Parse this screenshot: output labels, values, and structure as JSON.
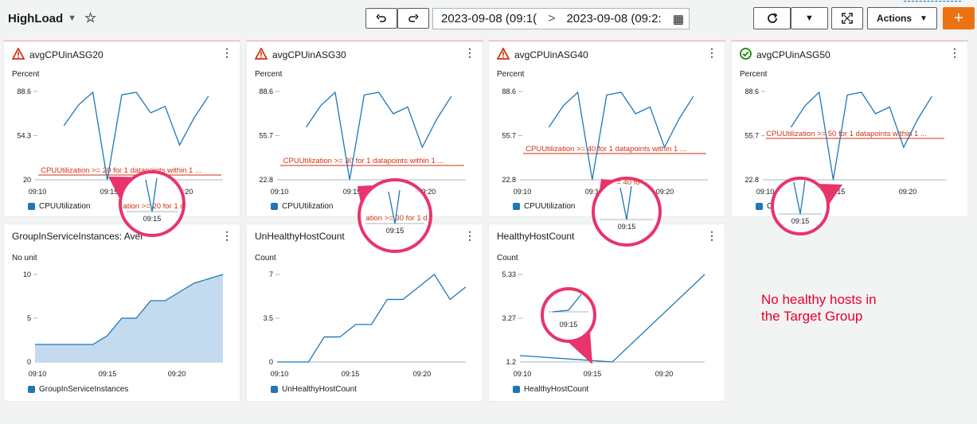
{
  "header": {
    "title": "HighLoad",
    "undo_icon": "undo-icon",
    "redo_icon": "redo-icon",
    "range_start": "2023-09-08 (09:1(",
    "range_end": "2023-09-08 (09:2:",
    "actions_label": "Actions",
    "add_label": "+"
  },
  "colors": {
    "series": "#1f77b4",
    "alarm": "#d13212",
    "ok": "#1d8102",
    "annotation": "#e8346b",
    "accent": "#ec7211"
  },
  "widgets": [
    {
      "title": "avgCPUinASG20",
      "status": "alarm",
      "unit": "Percent",
      "ticks": [
        "88.6",
        "54.3",
        "20"
      ],
      "xticks": [
        "09:10",
        "09:15",
        "09:20"
      ],
      "threshold_label": "CPUUtilization >= 20 for 1 datapoints within 1 ...",
      "legend": "CPUUtilization",
      "zoom_label": "09:15",
      "zoom_text": "ation >= 20 for 1 d"
    },
    {
      "title": "avgCPUinASG30",
      "status": "alarm",
      "unit": "Percent",
      "ticks": [
        "88.6",
        "55.7",
        "22.8"
      ],
      "xticks": [
        "09:10",
        "09:15",
        "09:20"
      ],
      "threshold_label": "CPUUtilization >= 30 for 1 datapoints within 1 ...",
      "legend": "CPUUtilization",
      "zoom_label": "09:15",
      "zoom_text": "ation >= 30 for 1 d"
    },
    {
      "title": "avgCPUinASG40",
      "status": "alarm",
      "unit": "Percent",
      "ticks": [
        "88.6",
        "55.7",
        "22.8"
      ],
      "xticks": [
        "09:10",
        "09:15",
        "09:20"
      ],
      "threshold_label": "CPUUtilization >= 40 for 1 datapoints within 1 ...",
      "legend": "CPUUtilization",
      "zoom_label": "09:15",
      "zoom_text": "= 40 fo"
    },
    {
      "title": "avgCPUinASG50",
      "status": "ok",
      "unit": "Percent",
      "ticks": [
        "88.6",
        "55.7",
        "22.8"
      ],
      "xticks": [
        "09:10",
        "09:15",
        "09:20"
      ],
      "threshold_label": "CPUUtilization >= 50 for 1 datapoints within 1 ...",
      "legend": "C",
      "zoom_label": "09:15",
      "zoom_text": ""
    },
    {
      "title": "GroupInServiceInstances: Average",
      "status": "none",
      "unit": "No unit",
      "ticks": [
        "10",
        "5",
        "0"
      ],
      "xticks": [
        "09:10",
        "09:15",
        "09:20"
      ],
      "legend": "GroupInServiceInstances"
    },
    {
      "title": "UnHealthyHostCount",
      "status": "none",
      "unit": "Count",
      "ticks": [
        "7",
        "3.5",
        "0"
      ],
      "xticks": [
        "09:10",
        "09:15",
        "09:20"
      ],
      "legend": "UnHealthyHostCount"
    },
    {
      "title": "HealthyHostCount",
      "status": "none",
      "unit": "Count",
      "ticks": [
        "5.33",
        "3.27",
        "1.2"
      ],
      "xticks": [
        "09:10",
        "09:15",
        "09:20"
      ],
      "legend": "HealthyHostCount",
      "zoom_label": "09:15",
      "zoom_text": ""
    }
  ],
  "note": "No healthy hosts in\nthe Target Group",
  "chart_data": [
    {
      "type": "line",
      "title": "avgCPUinASG20",
      "ylabel": "Percent",
      "ylim": [
        20,
        88.6
      ],
      "threshold": 20,
      "x": [
        "09:08",
        "09:10",
        "09:11",
        "09:12",
        "09:13",
        "09:14",
        "09:15",
        "09:16",
        "09:17",
        "09:18",
        "09:19",
        "09:20",
        "09:21",
        "09:22"
      ],
      "series": [
        {
          "name": "CPUUtilization",
          "values": [
            55,
            null,
            62,
            78,
            88,
            20,
            86,
            88,
            72,
            77,
            47,
            68,
            85,
            null
          ]
        }
      ]
    },
    {
      "type": "line",
      "title": "avgCPUinASG30",
      "ylabel": "Percent",
      "ylim": [
        22.8,
        88.6
      ],
      "threshold": 30,
      "x": [
        "09:08",
        "09:10",
        "09:11",
        "09:12",
        "09:13",
        "09:14",
        "09:15",
        "09:16",
        "09:17",
        "09:18",
        "09:19",
        "09:20",
        "09:21",
        "09:22"
      ],
      "series": [
        {
          "name": "CPUUtilization",
          "values": [
            55,
            null,
            62,
            78,
            88,
            22.8,
            86,
            88,
            72,
            77,
            47,
            68,
            85,
            null
          ]
        }
      ]
    },
    {
      "type": "line",
      "title": "avgCPUinASG40",
      "ylabel": "Percent",
      "ylim": [
        22.8,
        88.6
      ],
      "threshold": 40,
      "x": [
        "09:08",
        "09:10",
        "09:11",
        "09:12",
        "09:13",
        "09:14",
        "09:15",
        "09:16",
        "09:17",
        "09:18",
        "09:19",
        "09:20",
        "09:21",
        "09:22"
      ],
      "series": [
        {
          "name": "CPUUtilization",
          "values": [
            null,
            null,
            62,
            78,
            88,
            22.8,
            86,
            88,
            72,
            77,
            47,
            68,
            85,
            null
          ]
        }
      ]
    },
    {
      "type": "line",
      "title": "avgCPUinASG50",
      "ylabel": "Percent",
      "ylim": [
        22.8,
        88.6
      ],
      "threshold": 50,
      "x": [
        "09:08",
        "09:10",
        "09:11",
        "09:12",
        "09:13",
        "09:14",
        "09:15",
        "09:16",
        "09:17",
        "09:18",
        "09:19",
        "09:20",
        "09:21",
        "09:22"
      ],
      "series": [
        {
          "name": "CPUUtilization",
          "values": [
            null,
            null,
            62,
            78,
            88,
            22.8,
            86,
            88,
            72,
            77,
            47,
            68,
            85,
            null
          ]
        }
      ]
    },
    {
      "type": "area",
      "title": "GroupInServiceInstances: Average",
      "ylabel": "No unit",
      "ylim": [
        0,
        10
      ],
      "x": [
        "09:10",
        "09:11",
        "09:12",
        "09:13",
        "09:14",
        "09:15",
        "09:16",
        "09:17",
        "09:18",
        "09:19",
        "09:20",
        "09:21",
        "09:22",
        "09:23"
      ],
      "series": [
        {
          "name": "GroupInServiceInstances",
          "values": [
            2,
            2,
            2,
            2,
            2,
            3,
            5,
            5,
            7,
            7,
            8,
            9,
            9.5,
            10
          ]
        }
      ]
    },
    {
      "type": "line",
      "title": "UnHealthyHostCount",
      "ylabel": "Count",
      "ylim": [
        0,
        7
      ],
      "x": [
        "09:10",
        "09:11",
        "09:12",
        "09:13",
        "09:14",
        "09:15",
        "09:16",
        "09:17",
        "09:18",
        "09:19",
        "09:20",
        "09:21",
        "09:22"
      ],
      "series": [
        {
          "name": "UnHealthyHostCount",
          "values": [
            0,
            0,
            0,
            2,
            2,
            3,
            3,
            5,
            5,
            6,
            7,
            5,
            6
          ]
        }
      ]
    },
    {
      "type": "line",
      "title": "HealthyHostCount",
      "ylabel": "Count",
      "ylim": [
        1.2,
        5.33
      ],
      "x": [
        "09:10",
        "09:15",
        "09:20"
      ],
      "series": [
        {
          "name": "HealthyHostCount",
          "values": [
            1.5,
            1.2,
            5.33
          ]
        }
      ]
    }
  ]
}
